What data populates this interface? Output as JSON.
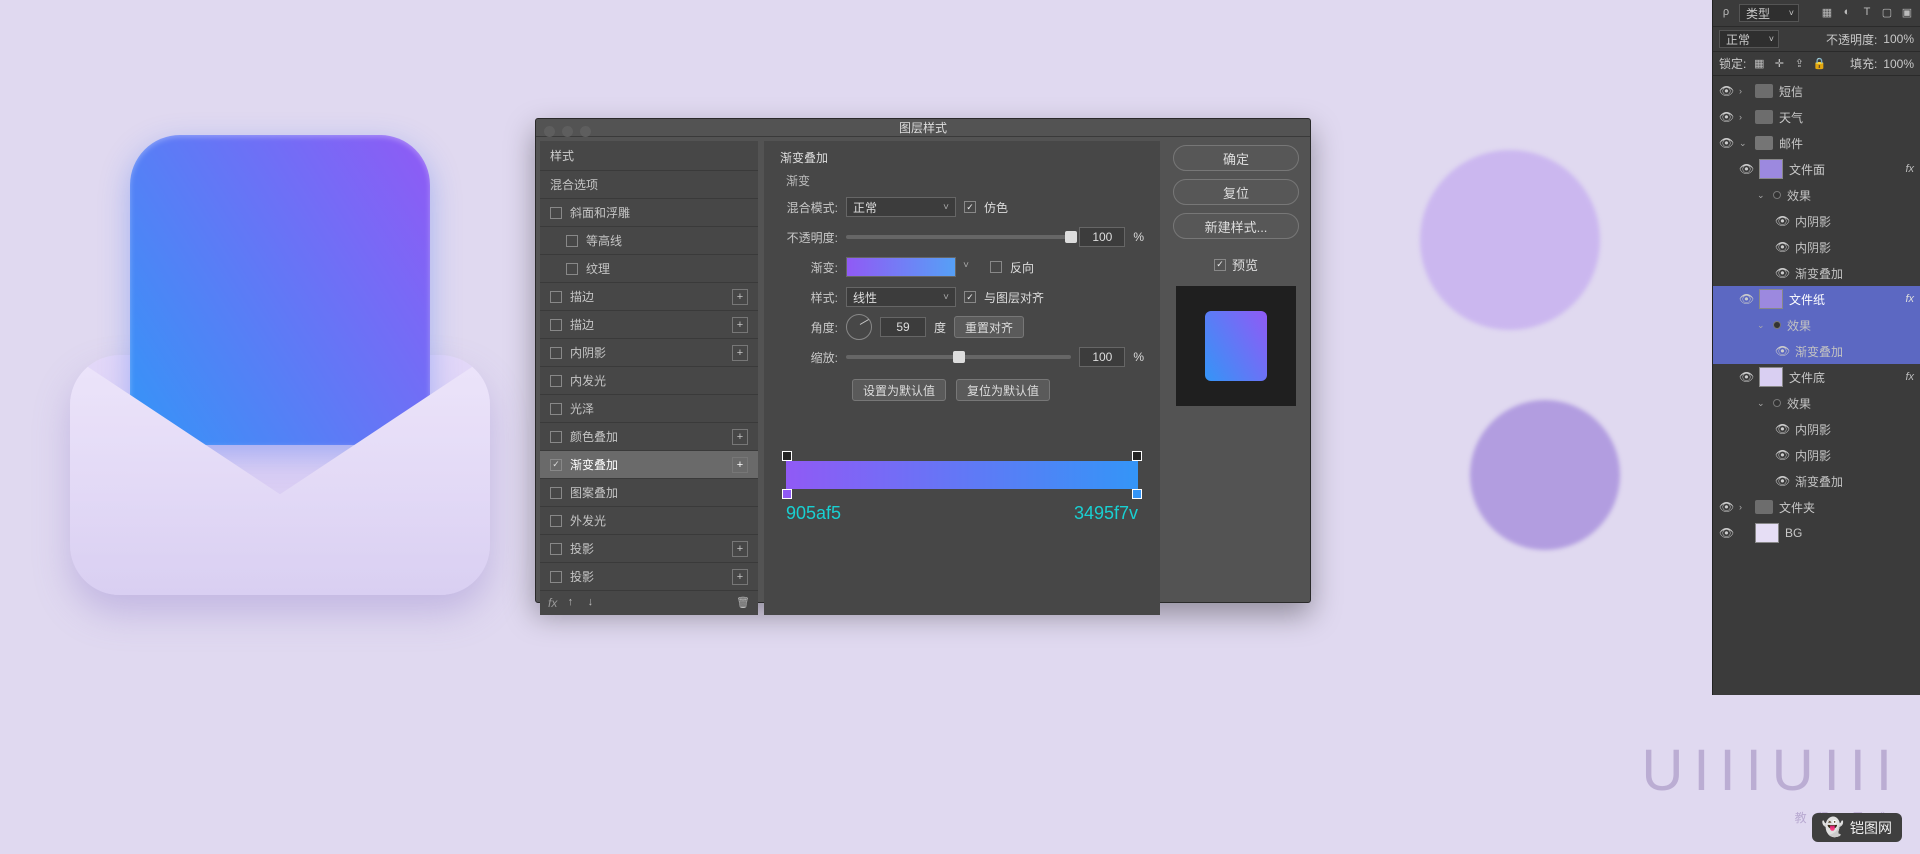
{
  "dialog": {
    "title": "图层样式",
    "styles_header": "样式",
    "blend_options": "混合选项",
    "style_items": [
      {
        "label": "斜面和浮雕",
        "checked": false,
        "plus": false,
        "indent": false
      },
      {
        "label": "等高线",
        "checked": false,
        "plus": false,
        "indent": true
      },
      {
        "label": "纹理",
        "checked": false,
        "plus": false,
        "indent": true
      },
      {
        "label": "描边",
        "checked": false,
        "plus": true,
        "indent": false
      },
      {
        "label": "描边",
        "checked": false,
        "plus": true,
        "indent": false
      },
      {
        "label": "内阴影",
        "checked": false,
        "plus": true,
        "indent": false
      },
      {
        "label": "内发光",
        "checked": false,
        "plus": false,
        "indent": false
      },
      {
        "label": "光泽",
        "checked": false,
        "plus": false,
        "indent": false
      },
      {
        "label": "颜色叠加",
        "checked": false,
        "plus": true,
        "indent": false
      },
      {
        "label": "渐变叠加",
        "checked": true,
        "plus": true,
        "indent": false,
        "selected": true
      },
      {
        "label": "图案叠加",
        "checked": false,
        "plus": false,
        "indent": false
      },
      {
        "label": "外发光",
        "checked": false,
        "plus": false,
        "indent": false
      },
      {
        "label": "投影",
        "checked": false,
        "plus": true,
        "indent": false
      },
      {
        "label": "投影",
        "checked": false,
        "plus": true,
        "indent": false
      }
    ],
    "fx_prefix": "fx",
    "gradient_overlay": {
      "title": "渐变叠加",
      "subtitle": "渐变",
      "blend_mode_label": "混合模式:",
      "blend_mode_value": "正常",
      "dither_label": "仿色",
      "dither": true,
      "opacity_label": "不透明度:",
      "opacity_value": "100",
      "opacity_unit": "%",
      "gradient_label": "渐变:",
      "reverse_label": "反向",
      "reverse": false,
      "style_label": "样式:",
      "style_value": "线性",
      "align_label": "与图层对齐",
      "align": true,
      "angle_label": "角度:",
      "angle_value": "59",
      "angle_unit": "度",
      "reset_align": "重置对齐",
      "scale_label": "缩放:",
      "scale_value": "100",
      "scale_unit": "%",
      "set_default": "设置为默认值",
      "reset_default": "复位为默认值"
    },
    "gradient_stops": {
      "left_hex": "905af5",
      "right_hex": "3495f7v"
    },
    "buttons": {
      "ok": "确定",
      "cancel": "复位",
      "new_style": "新建样式...",
      "preview": "预览"
    }
  },
  "layers_panel": {
    "top1": {
      "search_label": "类型",
      "rho": "ρ"
    },
    "row2": {
      "mode": "正常",
      "opacity_label": "不透明度:",
      "opacity": "100%"
    },
    "row3": {
      "lock_label": "锁定:",
      "fill_label": "填充:",
      "fill": "100%"
    },
    "groups": [
      {
        "type": "group",
        "name": "短信",
        "open": false
      },
      {
        "type": "group",
        "name": "天气",
        "open": false
      },
      {
        "type": "group",
        "name": "邮件",
        "open": true,
        "children": [
          {
            "type": "layer",
            "name": "文件面",
            "thumb": "purple",
            "fx": true,
            "effects": [
              "效果",
              "内阴影",
              "内阴影",
              "渐变叠加"
            ]
          },
          {
            "type": "layer",
            "name": "文件纸",
            "thumb": "purple",
            "fx": true,
            "selected": true,
            "effects": [
              "效果",
              "渐变叠加"
            ]
          },
          {
            "type": "layer",
            "name": "文件底",
            "thumb": "env",
            "fx": true,
            "effects": [
              "效果",
              "内阴影",
              "内阴影",
              "渐变叠加"
            ]
          }
        ]
      },
      {
        "type": "group",
        "name": "文件夹",
        "open": false
      },
      {
        "type": "layer",
        "name": "BG",
        "thumb": "bg"
      }
    ]
  },
  "watermark": {
    "big": "UIIIUIII",
    "sub": "教程 灵感",
    "badge": "铠图网"
  }
}
